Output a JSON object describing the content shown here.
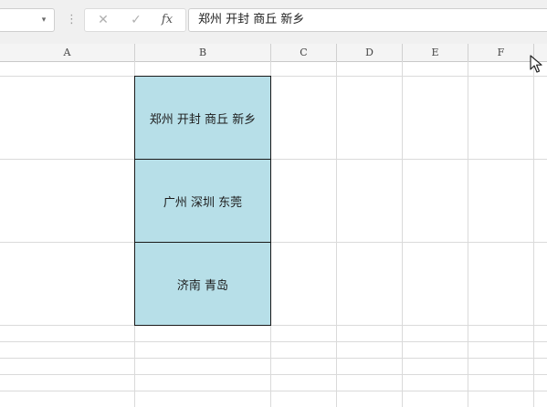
{
  "formula_bar": {
    "name_box_value": "",
    "name_box_arrow": "▾",
    "divider": "⋮",
    "cancel_symbol": "✕",
    "enter_symbol": "✓",
    "fx_symbol": "fx",
    "formula_value": "郑州 开封 商丘 新乡"
  },
  "columns": [
    "A",
    "B",
    "C",
    "D",
    "E",
    "F"
  ],
  "cells": [
    {
      "ref": "B2",
      "value": "郑州 开封 商丘 新乡"
    },
    {
      "ref": "B3",
      "value": "广州 深圳 东莞"
    },
    {
      "ref": "B4",
      "value": "济南 青岛"
    }
  ],
  "colors": {
    "cell_fill": "#b7dfe8",
    "cell_border": "#1a1a1a",
    "grid_line": "#dadada",
    "header_bg": "#f4f4f4"
  },
  "icons": {
    "cursor": "mouse-pointer-icon"
  }
}
